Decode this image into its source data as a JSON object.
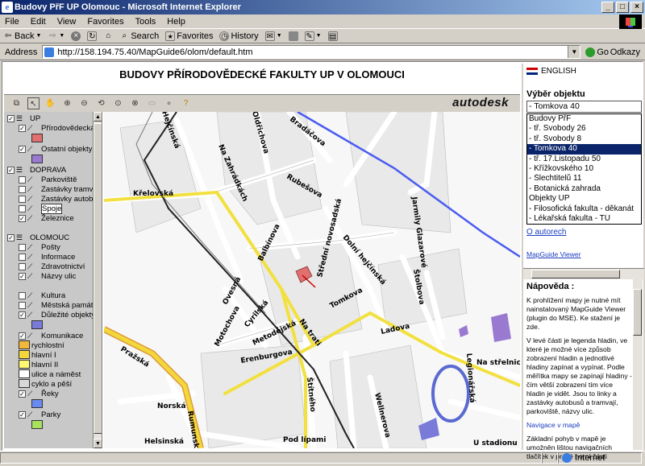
{
  "window": {
    "title": "Budovy PřF UP Olomouc - Microsoft Internet Explorer",
    "controls": [
      "_",
      "□",
      "×"
    ]
  },
  "menu": [
    "File",
    "Edit",
    "View",
    "Favorites",
    "Tools",
    "Help"
  ],
  "toolbar": {
    "back": "Back",
    "search": "Search",
    "favorites": "Favorites",
    "history": "History"
  },
  "address": {
    "label": "Address",
    "url": "http://158.194.75.40/MapGuide6/olom/default.htm",
    "go": "Go",
    "links": "Odkazy"
  },
  "page": {
    "title": "BUDOVY PŘÍRODOVĚDECKÉ FAKULTY UP V OLOMOUCI",
    "brand": "autodesk"
  },
  "layers": [
    {
      "label": "UP",
      "checked": true,
      "kind": "group"
    },
    {
      "label": "Přírodovědecká",
      "checked": true,
      "kind": "item"
    },
    {
      "label": "Ostatní objekty",
      "checked": true,
      "kind": "item"
    },
    {
      "label": "DOPRAVA",
      "checked": true,
      "kind": "group"
    },
    {
      "label": "Parkoviště",
      "checked": false,
      "kind": "item"
    },
    {
      "label": "Zastávky tramv",
      "checked": false,
      "kind": "item"
    },
    {
      "label": "Zastávky autob",
      "checked": false,
      "kind": "item"
    },
    {
      "label": "Spoje",
      "checked": false,
      "kind": "item"
    },
    {
      "label": "Železnice",
      "checked": true,
      "kind": "item"
    },
    {
      "label": "OLOMOUC",
      "checked": true,
      "kind": "group"
    },
    {
      "label": "Pošty",
      "checked": false,
      "kind": "item"
    },
    {
      "label": "Informace",
      "checked": false,
      "kind": "item"
    },
    {
      "label": "Zdravotnictví",
      "checked": false,
      "kind": "item"
    },
    {
      "label": "Názvy ulic",
      "checked": true,
      "kind": "item"
    },
    {
      "label": "Kultura",
      "checked": false,
      "kind": "item"
    },
    {
      "label": "Městská památ",
      "checked": false,
      "kind": "item"
    },
    {
      "label": "Důležité objekty",
      "checked": true,
      "kind": "item"
    },
    {
      "label": "Komunikace",
      "checked": true,
      "kind": "item"
    },
    {
      "label": "rychlostní",
      "kind": "legend"
    },
    {
      "label": "hlavní I",
      "kind": "legend"
    },
    {
      "label": "hlavní II",
      "kind": "legend"
    },
    {
      "label": "ulice a náměst",
      "kind": "legend"
    },
    {
      "label": "cyklo a pěší",
      "kind": "legend"
    },
    {
      "label": "Řeky",
      "checked": true,
      "kind": "item"
    },
    {
      "label": "Parky",
      "checked": true,
      "kind": "item"
    }
  ],
  "streets": [
    "Pražská",
    "Křelovská",
    "Norská",
    "Rumunská",
    "Helsinská",
    "Erenburgova",
    "Ladova",
    "Tomkova",
    "Balbínova",
    "Ovesná",
    "Motochova",
    "Cyrilská",
    "Metodějská",
    "Na trati",
    "Střední novosadská",
    "Dolní hejčínská",
    "Štolbova",
    "Jarmily Glazarové",
    "Rubešova",
    "Na Zahrádkách",
    "Bradáčova",
    "Pod lípami",
    "Na střelnici",
    "Wellnerova",
    "Legionářská",
    "U stadionu",
    "Štítného",
    "Oldřichova",
    "Hejčínská"
  ],
  "right": {
    "language": "ENGLISH",
    "select_title": "Výběr objektu",
    "selected": "- Tomkova 40",
    "options": [
      "Budovy PřF",
      "- tř. Svobody 26",
      "- tř. Svobody 8",
      "- Tomkova 40",
      "- tř. 17.Listopadu 50",
      "- Křížkovského 10",
      "- Šlechtitelů 11",
      "- Botanická zahrada",
      "Objekty UP",
      "- Filosofická fakulta - děkanát",
      "- Lékařská fakulta - TÚ"
    ],
    "about_link": "O autorech",
    "viewer_link": "MapGuide Viewer",
    "help_title": "Nápověda :",
    "help_p1": "K prohlížení mapy je nutné mít nainstalovaný MapGuide Viewer (plugin do MSE). Ke stažení je zde.",
    "help_p2": "V levé části je legenda hladin, ve které je možné více způsob zobrazení hladin a jednotlivé hladiny zapínat a vypínat. Podle měřítka mapy se zapínají hladiny - čím větší zobrazení tím více hladin je vidět. Jsou to linky a zastávky autobusů a tramvají, parkoviště, názvy ulic.",
    "help_link": "Navigace v mapě",
    "help_p3": "Základní pohyb v mapě je umožněn lištou navigačních tlačítek v pravé horní části"
  },
  "status": {
    "zone": "Internet"
  },
  "colors": {
    "title_bar": "#0a246a",
    "selection": "#0a246a",
    "road_major": "#f2d83a",
    "river": "#4a5cf0",
    "building_prf": "#e07070",
    "park": "#a8e060"
  }
}
